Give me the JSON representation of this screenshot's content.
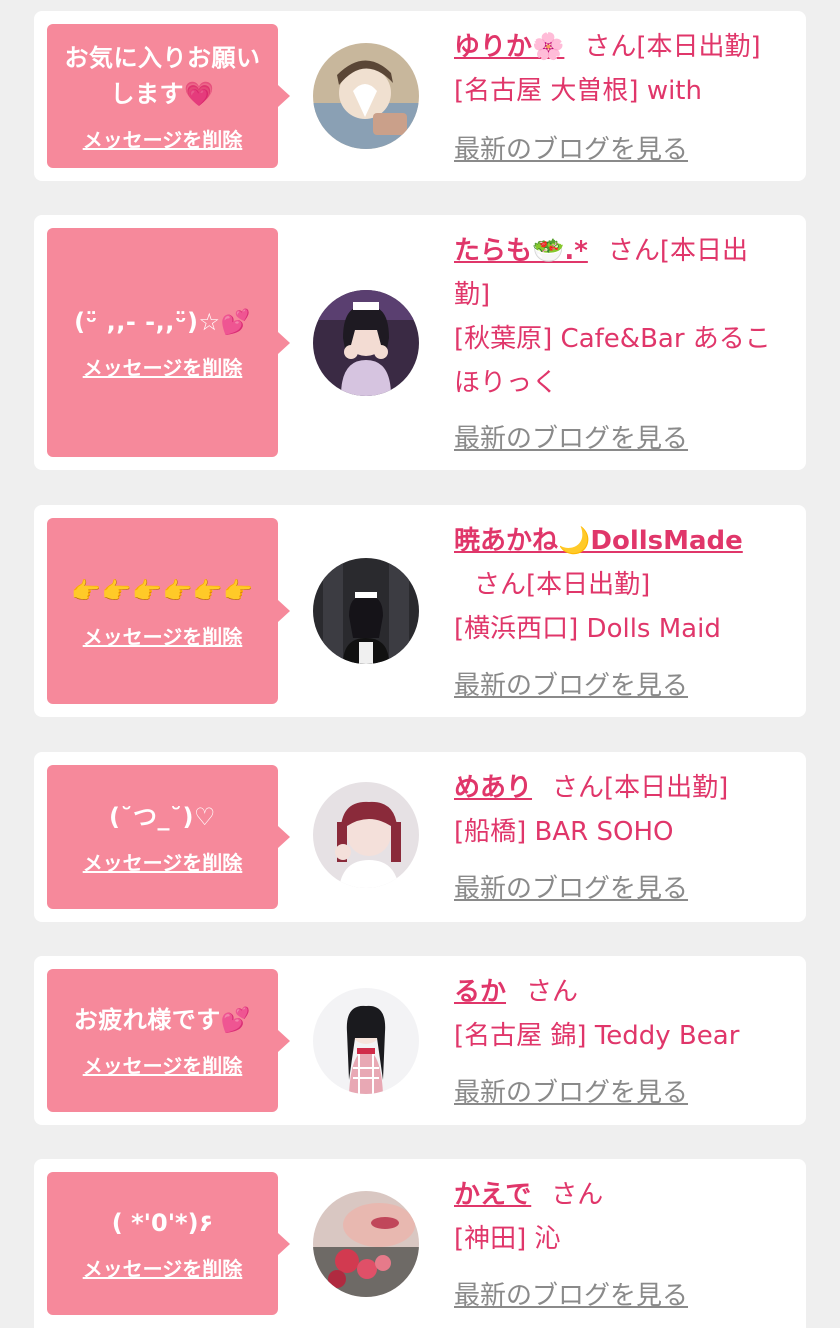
{
  "delete_label": "メッセージを削除",
  "blog_label": "最新のブログを見る",
  "colors": {
    "background": "#efefef",
    "bubble": "#f6899b",
    "accent": "#e0366a",
    "link_gray": "#8a8a8a"
  },
  "cards": [
    {
      "message": "お気に入りお願い\nします💗",
      "name": "ゆりか🌸",
      "suffix": "さん[本日出勤]",
      "shop": "[名古屋 大曽根] with"
    },
    {
      "message": "(ᵕ̈ ,,- -,,ᵕ̈)☆💕",
      "name": "たらも🥗.*",
      "suffix": "さん[本日出勤]",
      "shop": "[秋葉原] Cafe&Bar あるこほりっく"
    },
    {
      "message": "👉👉👉👉👉👉",
      "name": "暁あかね🌙DollsMade",
      "suffix": "さん[本日出勤]",
      "shop": "[横浜西口] Dolls Maid"
    },
    {
      "message": "(˘つ_˘)♡",
      "name": "めあり",
      "suffix": "さん[本日出勤]",
      "shop": "[船橋] BAR SOHO"
    },
    {
      "message": "お疲れ様です💕",
      "name": "るか",
      "suffix": "さん",
      "shop": "[名古屋 錦] Teddy Bear"
    },
    {
      "message": "( *'0'*)۶",
      "name": "かえで",
      "suffix": "さん",
      "shop": "[神田] 沁"
    }
  ]
}
